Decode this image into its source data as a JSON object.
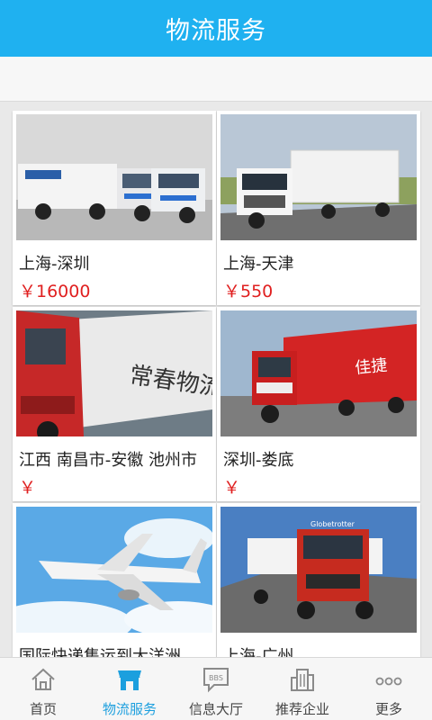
{
  "header": {
    "title": "物流服务"
  },
  "listings": [
    {
      "route": "上海-深圳",
      "price": "￥16000"
    },
    {
      "route": "上海-天津",
      "price": "￥550"
    },
    {
      "route": "江西 南昌市-安徽 池州市",
      "price": "￥"
    },
    {
      "route": "深圳-娄底",
      "price": "￥"
    },
    {
      "route": "国际快递集运到大洋洲",
      "price": ""
    },
    {
      "route": "上海-广州",
      "price": ""
    }
  ],
  "tabbar": {
    "items": [
      {
        "label": "首页",
        "icon": "home-icon"
      },
      {
        "label": "物流服务",
        "icon": "store-icon",
        "active": true
      },
      {
        "label": "信息大厅",
        "icon": "bbs-chat-icon"
      },
      {
        "label": "推荐企业",
        "icon": "building-icon"
      },
      {
        "label": "更多",
        "icon": "more-dots-icon"
      }
    ],
    "bbs_text": "BBS"
  },
  "colors": {
    "accent": "#1fb1f0",
    "price": "#e02020",
    "active_tab": "#1c9fde"
  }
}
